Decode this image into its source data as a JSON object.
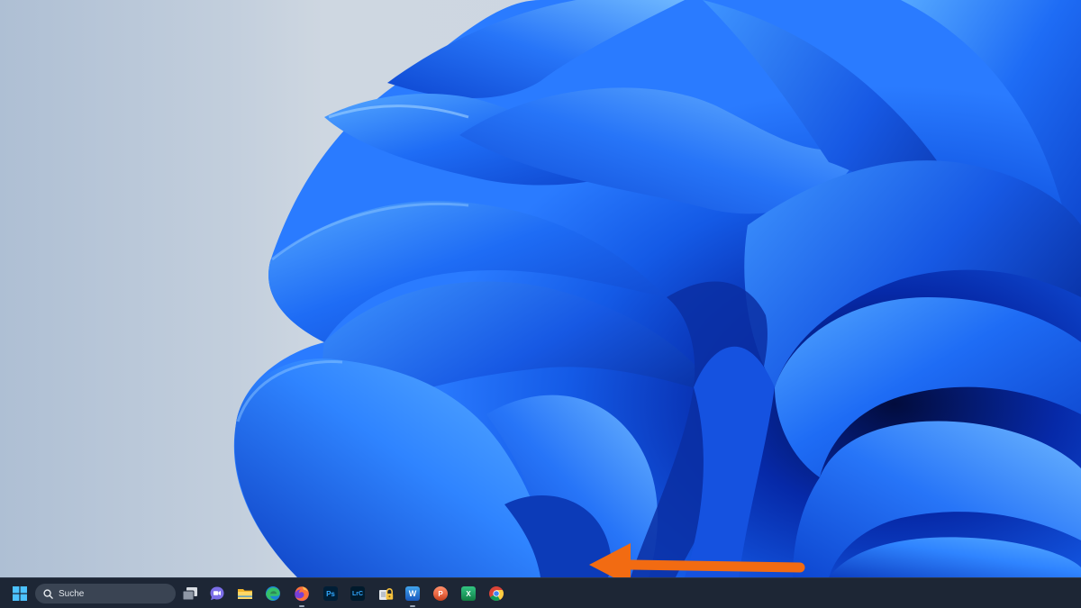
{
  "taskbar": {
    "search": {
      "label": "Suche"
    },
    "apps": [
      {
        "name": "Task View",
        "icon": "task-view-icon"
      },
      {
        "name": "Chat",
        "icon": "chat-icon"
      },
      {
        "name": "File Explorer",
        "icon": "folder-icon"
      },
      {
        "name": "Microsoft Edge",
        "icon": "edge-icon"
      },
      {
        "name": "Firefox",
        "icon": "firefox-icon",
        "running": true
      },
      {
        "name": "Photoshop",
        "icon": "photoshop-icon",
        "text": "Ps"
      },
      {
        "name": "Lightroom Classic",
        "icon": "lightroom-icon",
        "text": "LrC"
      },
      {
        "name": "Lock app",
        "icon": "lock-icon"
      },
      {
        "name": "Word",
        "icon": "word-icon",
        "text": "W",
        "running": true
      },
      {
        "name": "PowerPoint",
        "icon": "powerpoint-icon",
        "text": "P"
      },
      {
        "name": "Excel",
        "icon": "excel-icon",
        "text": "X"
      },
      {
        "name": "Chrome",
        "icon": "chrome-icon"
      }
    ]
  },
  "colors": {
    "taskbar_bg": "#1d2635",
    "arrow": "#f26b12",
    "wallpaper_blue": "#1a63f0",
    "desktop_bg": "#c3cfdd"
  }
}
